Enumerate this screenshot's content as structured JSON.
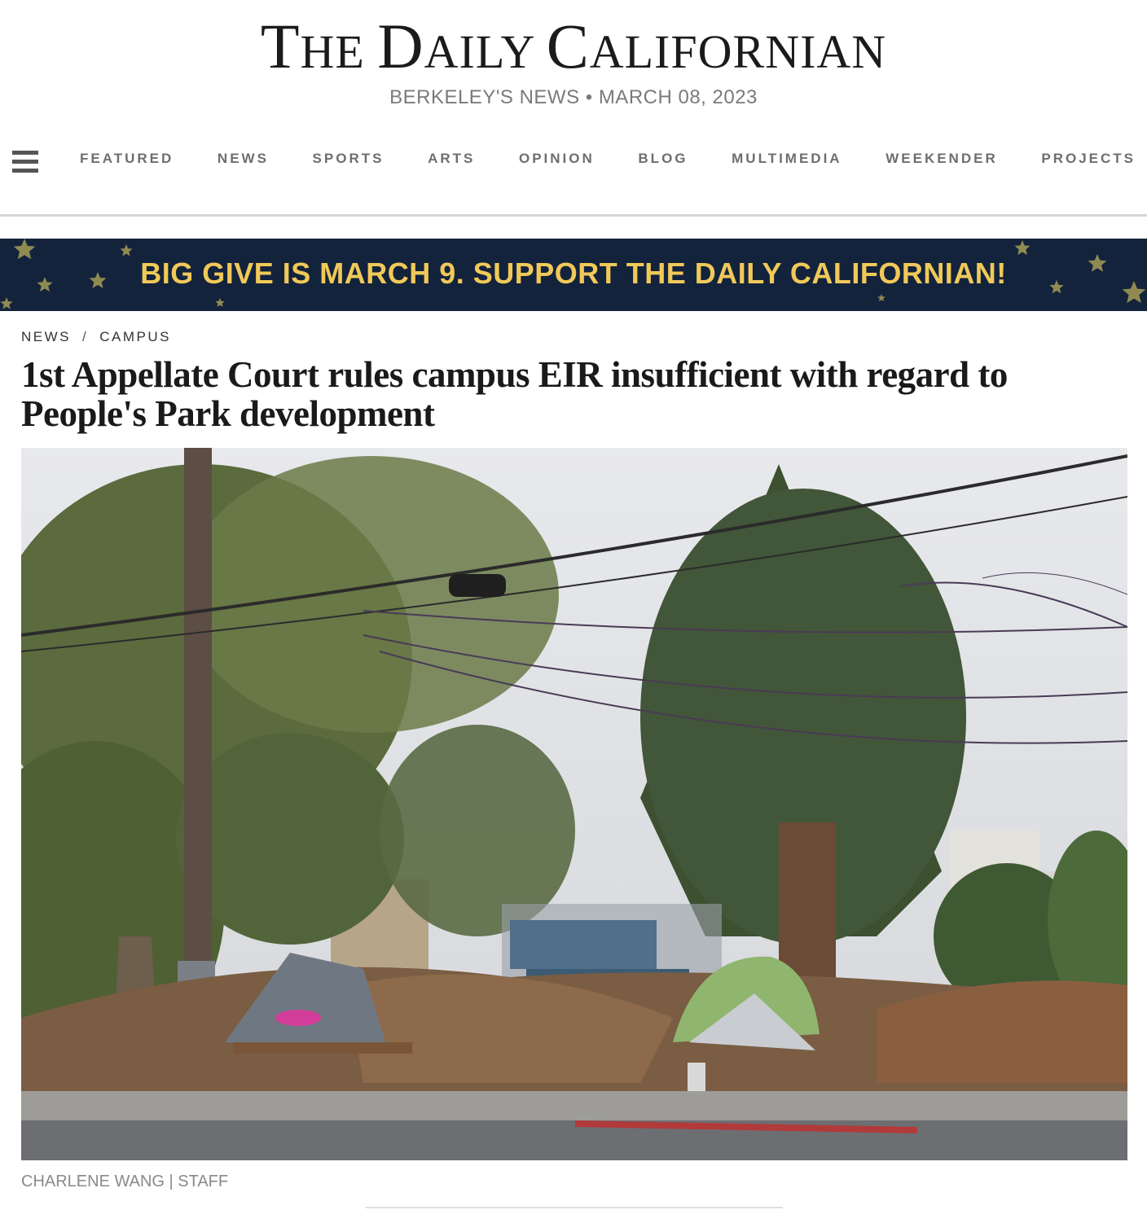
{
  "masthead": {
    "logo": [
      {
        "text": "T",
        "small": false
      },
      {
        "text": "HE ",
        "small": true
      },
      {
        "text": "D",
        "small": false
      },
      {
        "text": "AILY ",
        "small": true
      },
      {
        "text": "C",
        "small": false
      },
      {
        "text": "ALIFORNIAN",
        "small": true
      }
    ],
    "tagline": "BERKELEY'S NEWS • MARCH 08, 2023"
  },
  "nav": {
    "menu_icon": "hamburger-menu-icon",
    "items": [
      "FEATURED",
      "NEWS",
      "SPORTS",
      "ARTS",
      "OPINION",
      "BLOG",
      "MULTIMEDIA",
      "WEEKENDER",
      "PROJECTS"
    ]
  },
  "banner": {
    "text": "BIG GIVE IS MARCH 9. SUPPORT THE DAILY CALIFORNIAN!",
    "background": "#14233c",
    "text_color": "#f0c958",
    "decoration": "star-icon"
  },
  "breadcrumb": {
    "items": [
      "NEWS",
      "CAMPUS"
    ],
    "separator": "/"
  },
  "article": {
    "headline": "1st Appellate Court rules campus EIR insufficient with regard to People's Park development",
    "photo_credit": "CHARLENE WANG | STAFF"
  }
}
